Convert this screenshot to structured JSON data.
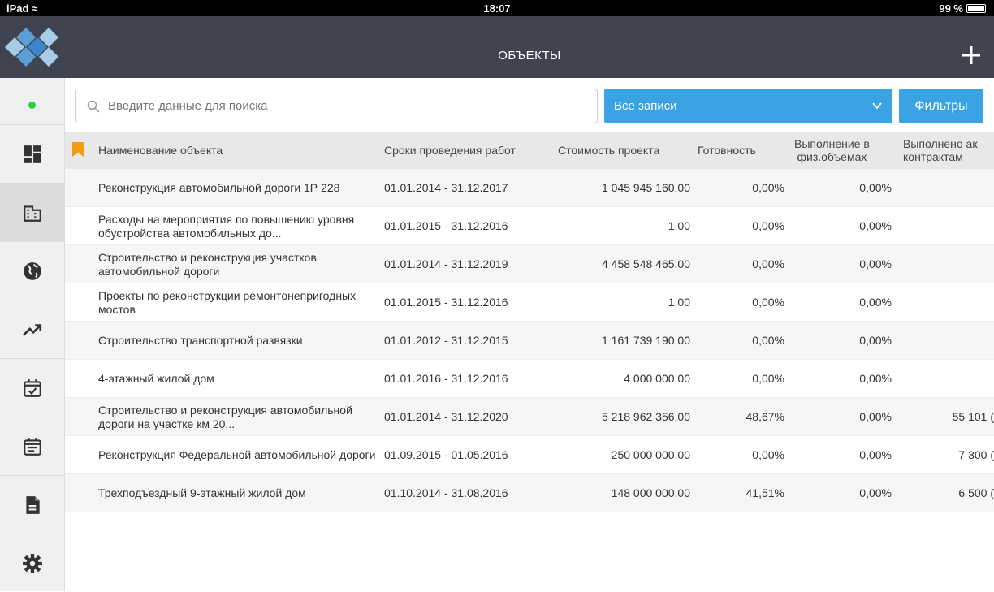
{
  "status_bar": {
    "device": "iPad",
    "time": "18:07",
    "battery": "99 %"
  },
  "header": {
    "title": "ОБЪЕКТЫ",
    "add_icon": "plus-icon"
  },
  "search": {
    "placeholder": "Введите данные для поиска"
  },
  "filter_select": {
    "value": "Все записи"
  },
  "filters_button": {
    "label": "Фильтры"
  },
  "colors": {
    "header_bg": "#3f4450",
    "accent": "#3aa3e3",
    "bookmark": "#f39c12",
    "online_dot": "#2ecc40"
  },
  "sidebar": {
    "items": [
      {
        "icon": "dashboard-icon"
      },
      {
        "icon": "building-icon",
        "active": true
      },
      {
        "icon": "globe-icon"
      },
      {
        "icon": "trending-up-icon"
      },
      {
        "icon": "calendar-check-icon"
      },
      {
        "icon": "calendar-list-icon"
      },
      {
        "icon": "document-icon"
      },
      {
        "icon": "gear-icon"
      }
    ]
  },
  "table": {
    "columns": {
      "name": "Наименование объекта",
      "dates": "Сроки проведения работ",
      "cost": "Стоимость проекта",
      "ready": "Готовность",
      "phys_line1": "Выполнение в",
      "phys_line2": "физ.объемах",
      "done_line1": "Выполнено ак",
      "done_line2": "контрактам"
    },
    "rows": [
      {
        "name": "Реконструкция автомобильной дороги 1Р 228",
        "dates": "01.01.2014 - 31.12.2017",
        "cost": "1 045 945 160,00",
        "ready": "0,00%",
        "phys": "0,00%",
        "done": ""
      },
      {
        "name": "Расходы на мероприятия по повышению уровня обустройства автомобильных до...",
        "dates": "01.01.2015 - 31.12.2016",
        "cost": "1,00",
        "ready": "0,00%",
        "phys": "0,00%",
        "done": ""
      },
      {
        "name": "Строительство и реконструкция участков автомобильной дороги",
        "dates": "01.01.2014 - 31.12.2019",
        "cost": "4 458 548 465,00",
        "ready": "0,00%",
        "phys": "0,00%",
        "done": ""
      },
      {
        "name": "Проекты по реконструкции ремонтонепригодных мостов",
        "dates": "01.01.2015 - 31.12.2016",
        "cost": "1,00",
        "ready": "0,00%",
        "phys": "0,00%",
        "done": ""
      },
      {
        "name": "Строительство транспортной развязки",
        "dates": "01.01.2012 - 31.12.2015",
        "cost": "1 161 739 190,00",
        "ready": "0,00%",
        "phys": "0,00%",
        "done": ""
      },
      {
        "name": "4-этажный жилой дом",
        "dates": "01.01.2016 - 31.12.2016",
        "cost": "4 000 000,00",
        "ready": "0,00%",
        "phys": "0,00%",
        "done": ""
      },
      {
        "name": "Строительство и реконструкция автомобильной дороги на участке км 20...",
        "dates": "01.01.2014 - 31.12.2020",
        "cost": "5 218 962 356,00",
        "ready": "48,67%",
        "phys": "0,00%",
        "done": "55 101 ("
      },
      {
        "name": "Реконструкция Федеральной автомобильной дороги",
        "dates": "01.09.2015 - 01.05.2016",
        "cost": "250 000 000,00",
        "ready": "0,00%",
        "phys": "0,00%",
        "done": "7 300 ("
      },
      {
        "name": "Трехподъездный 9-этажный жилой дом",
        "dates": "01.10.2014 - 31.08.2016",
        "cost": "148 000 000,00",
        "ready": "41,51%",
        "phys": "0,00%",
        "done": "6 500 ("
      }
    ]
  }
}
